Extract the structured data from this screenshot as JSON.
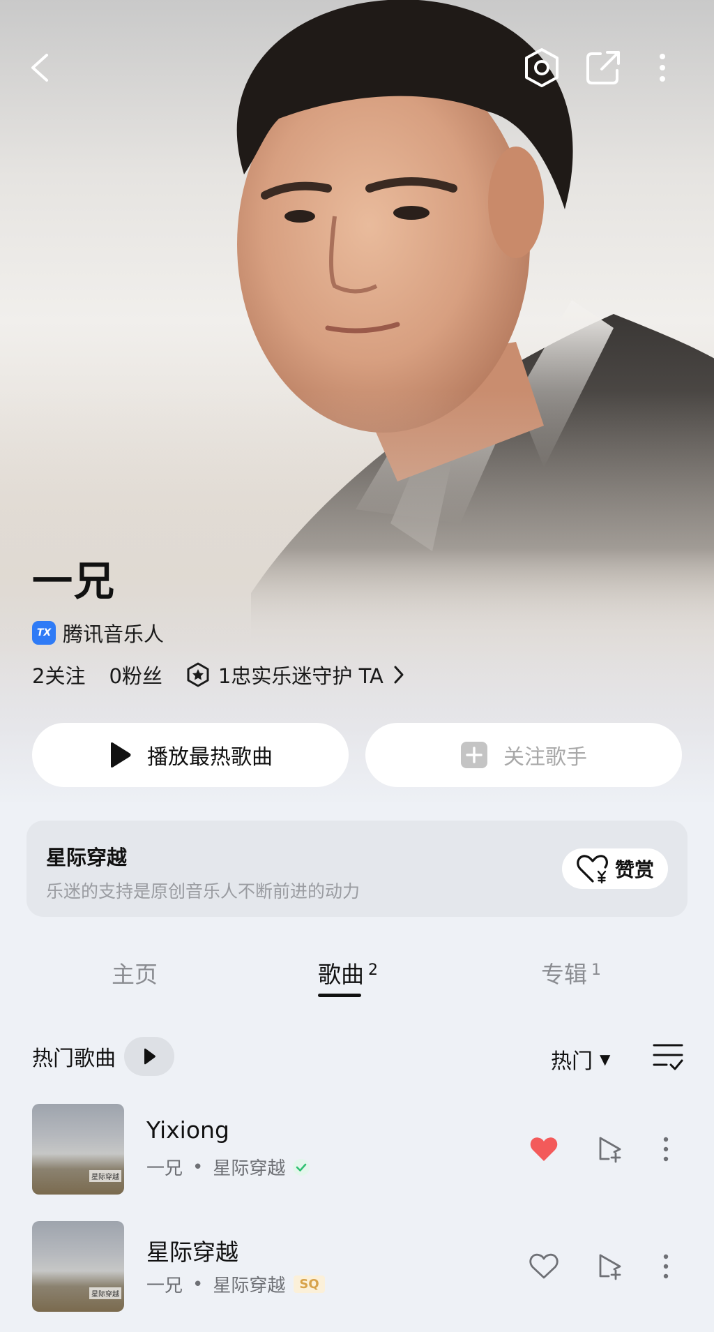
{
  "artist": {
    "name": "一兄",
    "badge_logo_text": "TX",
    "badge_text": "腾讯音乐人"
  },
  "stats": {
    "following": "2关注",
    "fans": "0粉丝",
    "guard": "1忠实乐迷守护 TA"
  },
  "actions": {
    "play_hot": "播放最热歌曲",
    "follow": "关注歌手"
  },
  "support_card": {
    "title": "星际穿越",
    "subtitle": "乐迷的支持是原创音乐人不断前进的动力",
    "reward_label": "赞赏"
  },
  "tabs": [
    {
      "label": "主页",
      "count": ""
    },
    {
      "label": "歌曲",
      "count": "2"
    },
    {
      "label": "专辑",
      "count": "1"
    }
  ],
  "hot_songs": {
    "title": "热门歌曲",
    "sort_label": "热门"
  },
  "songs": [
    {
      "title": "Yixiong",
      "artist": "一兄",
      "album": "星际穿越",
      "tag": "",
      "liked": true,
      "cover_text": "星际穿越"
    },
    {
      "title": "星际穿越",
      "artist": "一兄",
      "album": "星际穿越",
      "tag": "SQ",
      "liked": false,
      "cover_text": "星际穿越"
    }
  ],
  "colors": {
    "accent_red": "#f35a5a",
    "badge_blue": "#2f7bf6",
    "check_green": "#2fc071",
    "sq_gold": "#d7a24a"
  },
  "dot": "•",
  "tri": "▼"
}
